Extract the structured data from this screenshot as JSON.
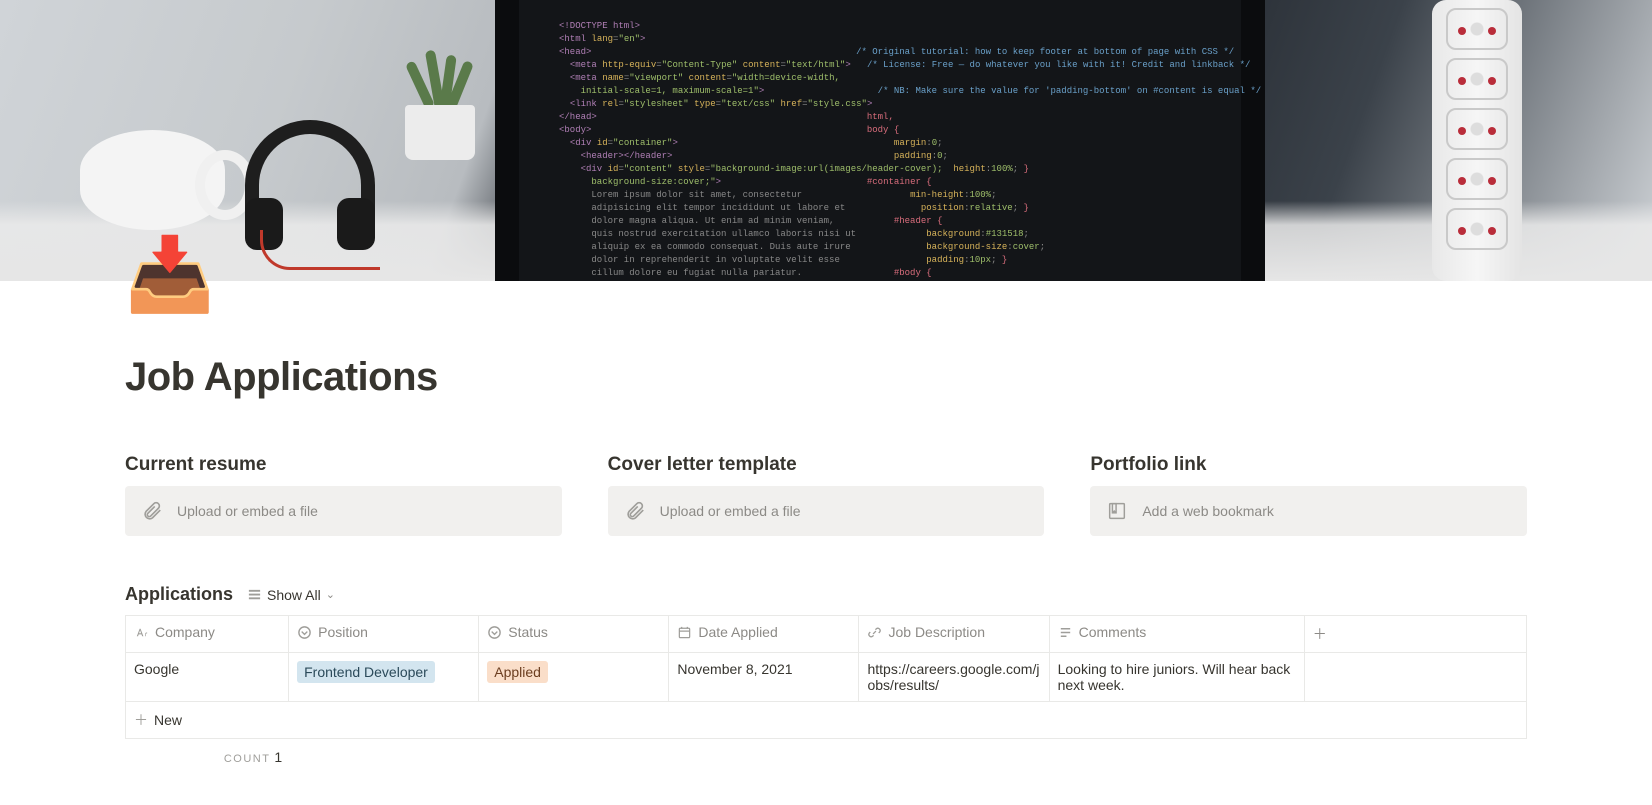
{
  "page": {
    "icon": "📥",
    "title": "Job Applications"
  },
  "sections": {
    "resume": {
      "heading": "Current resume",
      "placeholder": "Upload or embed a file"
    },
    "cover": {
      "heading": "Cover letter template",
      "placeholder": "Upload or embed a file"
    },
    "portfolio": {
      "heading": "Portfolio link",
      "placeholder": "Add a web bookmark"
    }
  },
  "database": {
    "title": "Applications",
    "view_label": "Show All",
    "columns": {
      "company": "Company",
      "position": "Position",
      "status": "Status",
      "date": "Date Applied",
      "jd": "Job Description",
      "comments": "Comments"
    },
    "rows": [
      {
        "company": "Google",
        "position": "Frontend Developer",
        "status": "Applied",
        "date": "November 8, 2021",
        "jd": "https://careers.google.com/jobs/results/",
        "comments": "Looking to hire juniors. Will hear back next week."
      }
    ],
    "new_row_label": "New",
    "footer": {
      "label": "COUNT",
      "value": "1"
    }
  }
}
